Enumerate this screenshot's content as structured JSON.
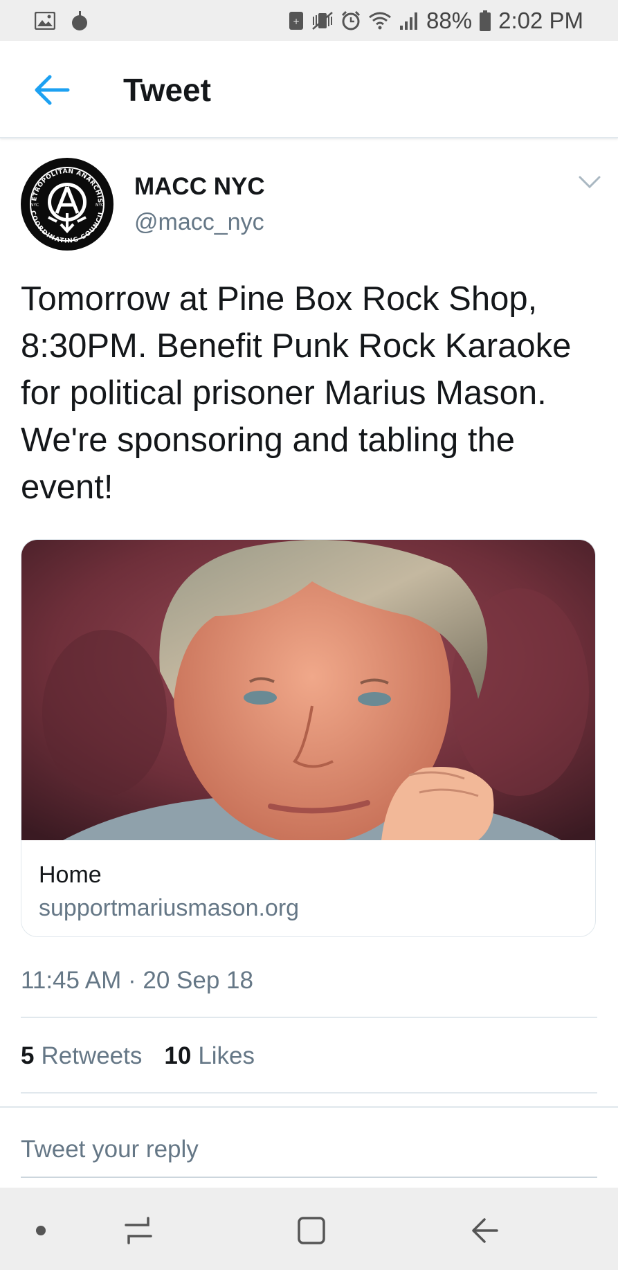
{
  "status_bar": {
    "battery": "88%",
    "time": "2:02 PM"
  },
  "header": {
    "title": "Tweet"
  },
  "tweet": {
    "author_name": "MACC NYC",
    "author_handle": "@macc_nyc",
    "avatar_text_top": "METROPOLITAN ANARCHIST",
    "avatar_text_bottom": "COORDINATING COUNCIL",
    "avatar_text_sides": "NYC",
    "text": "Tomorrow at Pine Box Rock Shop, 8:30PM. Benefit Punk Rock Karaoke for political prisoner Marius Mason. We're sponsoring and tabling the event!",
    "card": {
      "title": "Home",
      "domain": "supportmariusmason.org"
    },
    "timestamp": "11:45 AM · 20 Sep 18",
    "retweets_count": "5",
    "retweets_label": "Retweets",
    "likes_count": "10",
    "likes_label": "Likes"
  },
  "reply": {
    "placeholder": "Tweet your reply"
  },
  "colors": {
    "accent": "#1da1f2",
    "secondary_text": "#657786"
  }
}
